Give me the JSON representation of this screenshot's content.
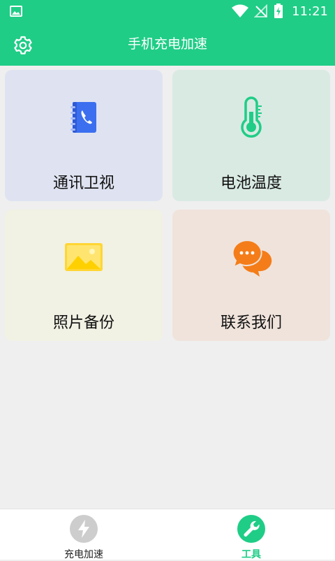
{
  "status_bar": {
    "time": "11:21"
  },
  "app_bar": {
    "title": "手机充电加速"
  },
  "cards": [
    {
      "label": "通讯卫视",
      "icon": "contacts-book-icon"
    },
    {
      "label": "电池温度",
      "icon": "thermometer-icon"
    },
    {
      "label": "照片备份",
      "icon": "photo-icon"
    },
    {
      "label": "联系我们",
      "icon": "chat-bubbles-icon"
    }
  ],
  "bottom_nav": [
    {
      "label": "充电加速",
      "icon": "lightning-icon",
      "active": false
    },
    {
      "label": "工具",
      "icon": "wrench-icon",
      "active": true
    }
  ],
  "colors": {
    "brand": "#1fcd86",
    "contacts_blue": "#3b6ff0",
    "thermo_green": "#1fcd86",
    "photo_yellow": "#ffd633",
    "chat_orange": "#f47d19"
  }
}
